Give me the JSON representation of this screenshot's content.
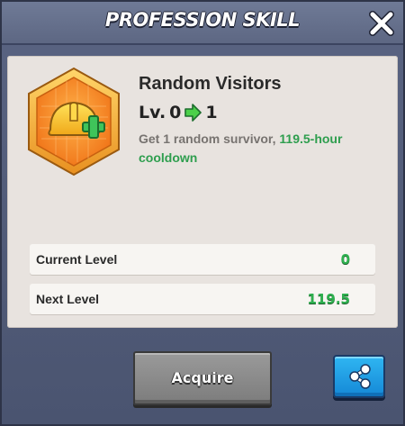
{
  "header": {
    "title": "PROFESSION SKILL",
    "close_icon": "close-icon"
  },
  "skill": {
    "icon": "hardhat-plus-icon",
    "name": "Random Visitors",
    "level_prefix": "Lv.",
    "level_from": "0",
    "level_to": "1",
    "description_prefix": "Get 1 random survivor, ",
    "description_highlight": "119.5-hour cooldown",
    "highlight_color": "#2e9e4e"
  },
  "stats": [
    {
      "label": "Current Level",
      "value": "0"
    },
    {
      "label": "Next Level",
      "value": "119.5"
    }
  ],
  "actions": {
    "acquire_label": "Acquire",
    "share_icon": "share-icon"
  },
  "colors": {
    "badge_gold": "#f0a02a",
    "badge_orange": "#f07a1a",
    "value_green": "#2eb04f",
    "share_blue": "#1d9be6"
  }
}
